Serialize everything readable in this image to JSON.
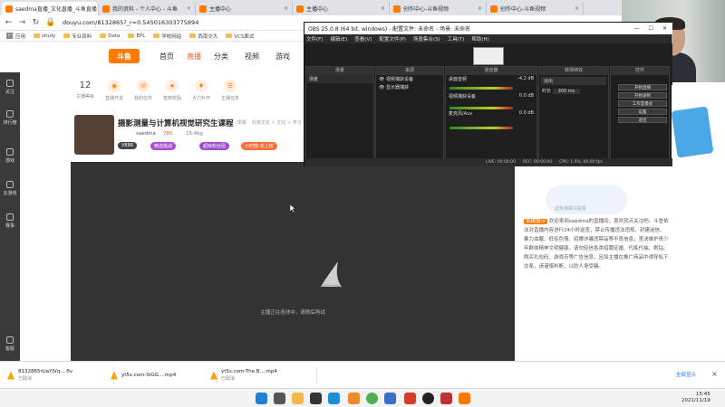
{
  "browser": {
    "tabs": [
      {
        "label": "saedma直播_文化直播_斗鱼直播",
        "active": true
      },
      {
        "label": "我的资料 - 个人中心 - 斗鱼"
      },
      {
        "label": "主播中心"
      },
      {
        "label": "主播中心"
      },
      {
        "label": "创作中心-斗鱼视频"
      },
      {
        "label": "创作中心-斗鱼视频"
      }
    ],
    "url": "douyu.com/8132865?_r=0.5450163037758​94",
    "bookmarks": [
      "应用",
      "study",
      "专业资料",
      "Data",
      "EPL",
      "学校网站",
      "西南交大",
      "VCS面试"
    ]
  },
  "site": {
    "logo": "斗鱼",
    "nav": [
      "首页",
      "直播",
      "分类",
      "视频",
      "游戏"
    ],
    "rail": [
      "关注",
      "排行榜",
      "游戏",
      "云游戏",
      "赛事",
      "客服"
    ],
    "tasks": [
      {
        "value": "12",
        "label": "主播等级"
      },
      {
        "label": "直播开关"
      },
      {
        "label": "我的任务"
      },
      {
        "label": "签到奖励"
      },
      {
        "label": "大力补开"
      },
      {
        "label": "主播任务"
      }
    ],
    "room": {
      "title": "摄影测量与计算机视觉研究生课程",
      "category": "科技文化 > 文化 > 学习",
      "report": "举报",
      "streamer": "saedma",
      "hot": "780",
      "viewers": "15.4kg",
      "pills": [
        "V888",
        "精选挑战",
        "超级粉丝团",
        "小时榜 未上榜"
      ]
    },
    "player_msg": "主播正在连线中，请稍后再试",
    "chat_banner": "这条弹幕只能看",
    "chat_tag": "系统提示",
    "chat_text": "欢迎来到saedma的直播间，喜欢就点关注吧。斗鱼依法对直播内容进行24小时巡查，禁止传播违法违规、封建迷信、暴力血腥、低俗色情、招嫖诈骗违禁品等不良信息，坚决维护青少年群体精神文明健康。请勿轻信各类招聘征婚、代练代抽、刷钻、购买礼包码、游戏币等广告信息，且如主播在推广商品中诱导私下交易，请谨慎判断，以防人身受骗。"
  },
  "obs": {
    "title": "OBS 25.0.8 (64 bit, windows) - 配置文件: 未命名 - 场景: 未命名",
    "menu": [
      "文件(F)",
      "编辑(E)",
      "查看(V)",
      "配置文件(P)",
      "场景集合(S)",
      "工具(T)",
      "帮助(H)"
    ],
    "docks": [
      "场景",
      "来源",
      "混音器",
      "转场特效",
      "控件"
    ],
    "scene": "场景",
    "sources": [
      "视频捕获设备",
      "显示器捕获"
    ],
    "mixer": [
      {
        "label": "桌面音频",
        "db": "-4.2 dB"
      },
      {
        "label": "视频捕获设备",
        "db": "0.0 dB"
      },
      {
        "label": "麦克风/Aux",
        "db": "0.0 dB"
      }
    ],
    "transition": "淡出",
    "duration_label": "时长",
    "duration": "300 ms",
    "controls": [
      "开始直播",
      "开始录制",
      "工作室模式",
      "设置",
      "退出"
    ],
    "status": [
      "LIVE: 00:00:00",
      "REC: 00:00:00",
      "CPU: 1.0%, 60.00 fps"
    ]
  },
  "downloads": [
    {
      "name": "8132865rUaYjVq....flv",
      "status": "已取消"
    },
    {
      "name": "yt5s.com-SIGG....mp4",
      "status": ""
    },
    {
      "name": "yt5s.com-The B....mp4",
      "status": "已取消"
    }
  ],
  "downloads_showall": "全部显示",
  "clock": {
    "time": "15:45",
    "date": "2021/11/19"
  }
}
